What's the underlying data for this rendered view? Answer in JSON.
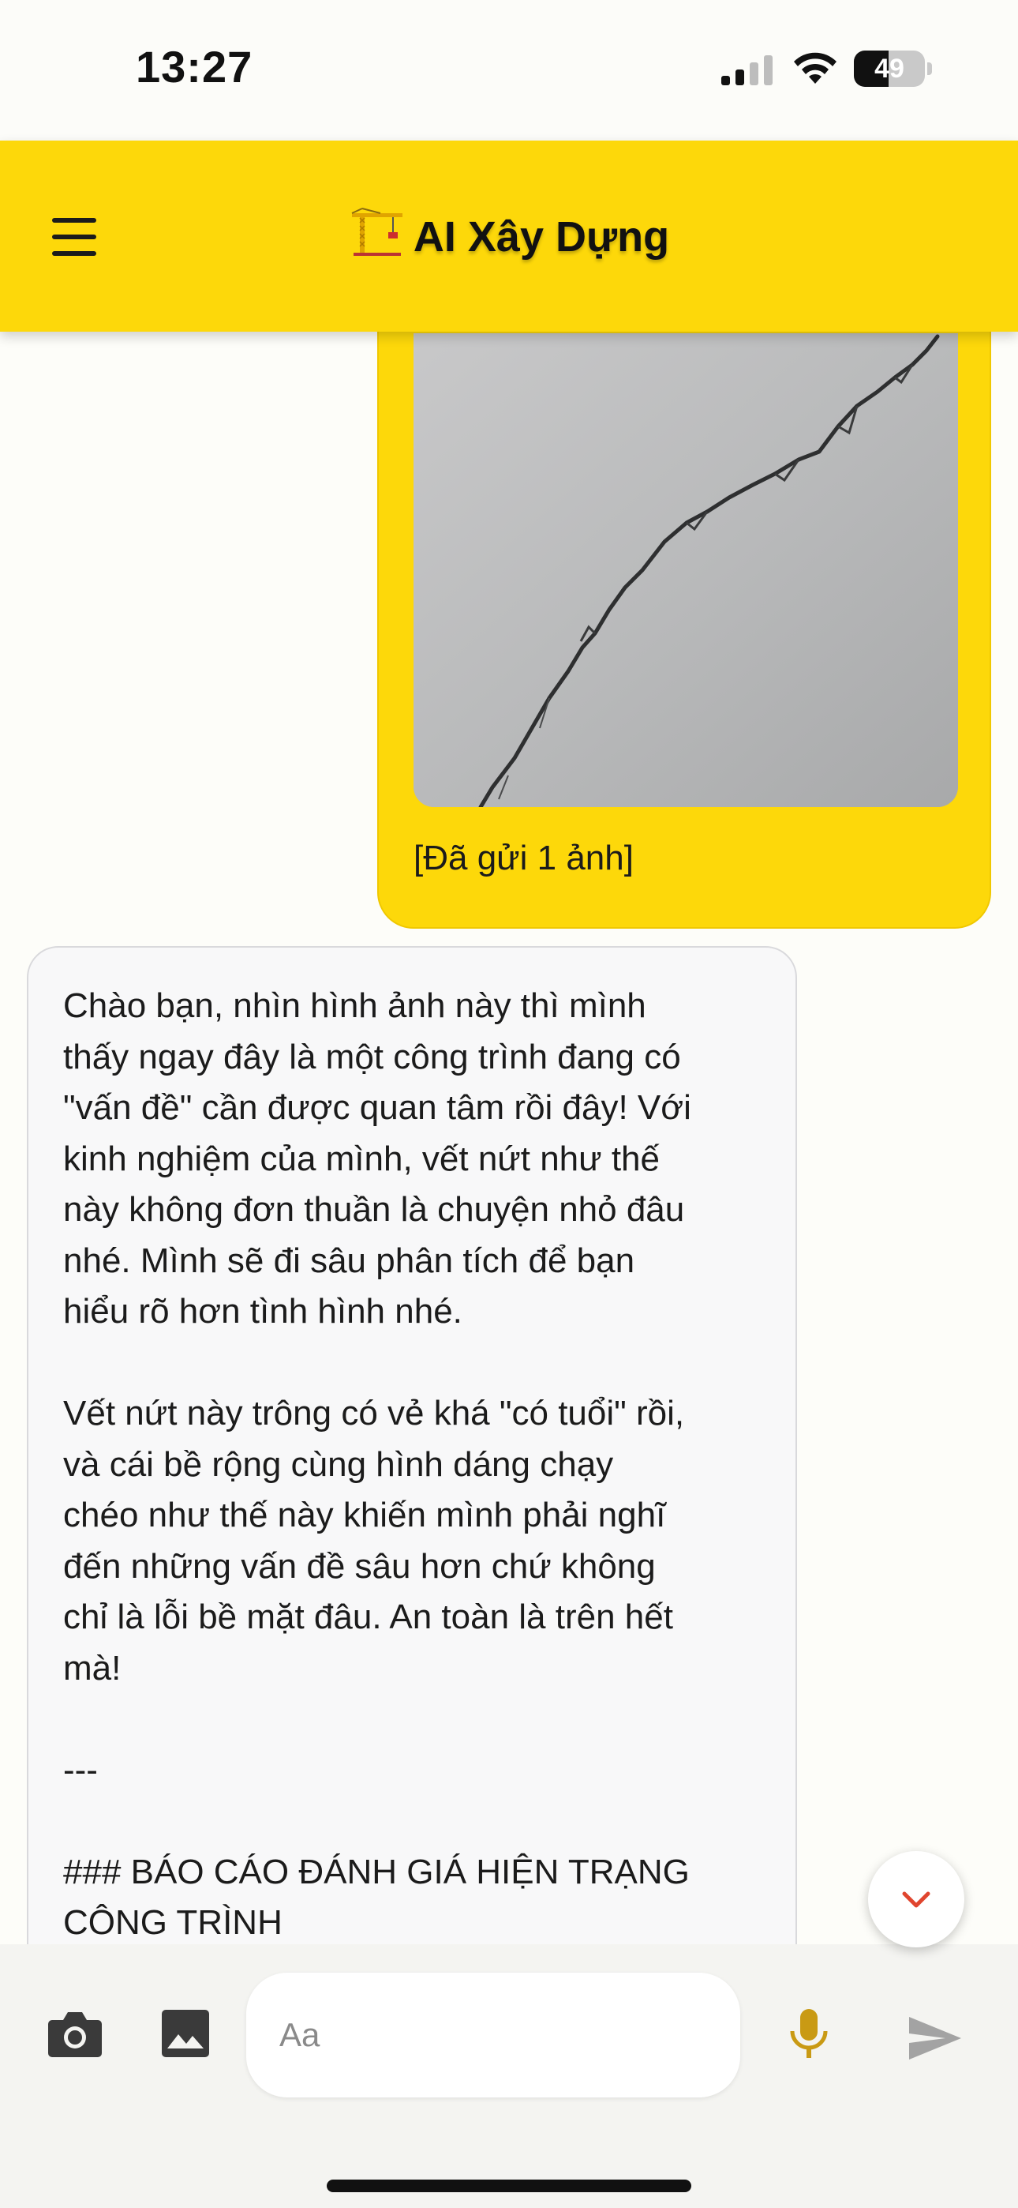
{
  "status_bar": {
    "time": "13:27",
    "battery_level": "49",
    "battery_fraction": 0.49,
    "icons": [
      "signal-icon",
      "wifi-icon",
      "battery-icon"
    ]
  },
  "header": {
    "title": "AI Xây Dựng",
    "title_icon": "construction-crane-icon",
    "menu_icon": "hamburger-menu-icon",
    "background_color": "#fdd80a"
  },
  "chat": {
    "messages": [
      {
        "role": "user",
        "attachment": "photo-wall-crack",
        "caption": "[Đã gửi 1 ảnh]"
      },
      {
        "role": "assistant",
        "text": "Chào bạn, nhìn hình ảnh này thì mình\nthấy ngay đây là một công trình đang có\n\"vấn đề\" cần được quan tâm rồi đây! Với\nkinh nghiệm của mình, vết nứt như thế\nnày không đơn thuần là chuyện nhỏ đâu\nnhé. Mình sẽ đi sâu phân tích để bạn\nhiểu rõ hơn tình hình nhé.\n\nVết nứt này trông có vẻ khá \"có tuổi\" rồi,\nvà cái bề rộng cùng hình dáng chạy\nchéo như thế này khiến mình phải nghĩ\nđến những vấn đề sâu hơn chứ không\nchỉ là lỗi bề mặt đâu. An toàn là trên hết\nmà!\n\n---\n\n### BÁO CÁO ĐÁNH GIÁ HIỆN TRẠNG\nCÔNG TRÌNH"
      }
    ],
    "scroll_button_icon": "chevron-down-icon"
  },
  "input_bar": {
    "placeholder": "Aa",
    "value": "",
    "icons": [
      "camera-icon",
      "image-icon",
      "microphone-icon",
      "send-icon"
    ],
    "mic_color": "#c99a14",
    "send_color": "#a3a3a3"
  }
}
